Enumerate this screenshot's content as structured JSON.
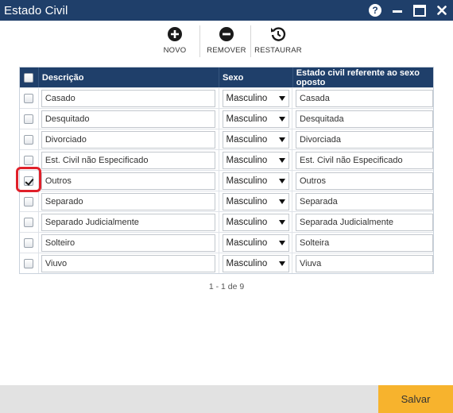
{
  "window": {
    "title": "Estado Civil"
  },
  "toolbar": {
    "novo_label": "NOVO",
    "remover_label": "REMOVER",
    "restaurar_label": "RESTAURAR"
  },
  "table": {
    "headers": {
      "descricao": "Descrição",
      "sexo": "Sexo",
      "oposto": "Estado civil referente ao sexo oposto"
    },
    "rows": [
      {
        "checked": false,
        "descricao": "Casado",
        "sexo": "Masculino",
        "oposto": "Casada"
      },
      {
        "checked": false,
        "descricao": "Desquitado",
        "sexo": "Masculino",
        "oposto": "Desquitada"
      },
      {
        "checked": false,
        "descricao": "Divorciado",
        "sexo": "Masculino",
        "oposto": "Divorciada"
      },
      {
        "checked": false,
        "descricao": "Est. Civil não Especificado",
        "sexo": "Masculino",
        "oposto": "Est. Civil não Especificado"
      },
      {
        "checked": true,
        "descricao": "Outros",
        "sexo": "Masculino",
        "oposto": "Outros"
      },
      {
        "checked": false,
        "descricao": "Separado",
        "sexo": "Masculino",
        "oposto": "Separada"
      },
      {
        "checked": false,
        "descricao": "Separado Judicialmente",
        "sexo": "Masculino",
        "oposto": "Separada Judicialmente"
      },
      {
        "checked": false,
        "descricao": "Solteiro",
        "sexo": "Masculino",
        "oposto": "Solteira"
      },
      {
        "checked": false,
        "descricao": "Viuvo",
        "sexo": "Masculino",
        "oposto": "Viuva"
      }
    ]
  },
  "pager": {
    "text": "1 - 1 de 9"
  },
  "footer": {
    "save_label": "Salvar"
  },
  "colors": {
    "titlebar": "#1f3f6a",
    "header": "#1f3f6a",
    "save": "#f7b32d",
    "highlight": "#e0202a"
  },
  "icons": [
    "help-icon",
    "minimize-icon",
    "maximize-icon",
    "close-icon",
    "plus-circle-icon",
    "minus-circle-icon",
    "restore-icon"
  ]
}
